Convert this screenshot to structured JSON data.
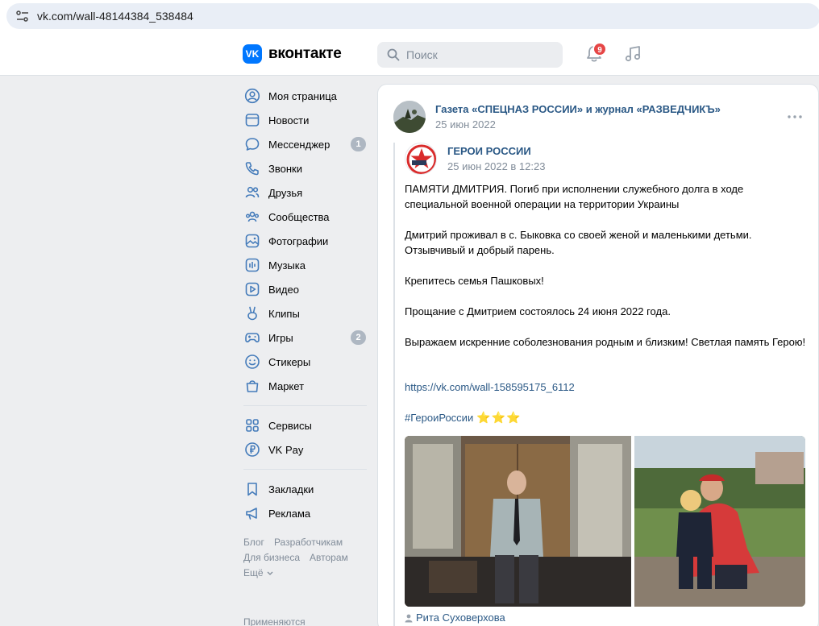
{
  "browser": {
    "url": "vk.com/wall-48144384_538484"
  },
  "header": {
    "logo_text": "вконтакте",
    "logo_mark": "VK",
    "search_placeholder": "Поиск",
    "notifications_count": "9",
    "brand_color": "#0077ff"
  },
  "sidebar": {
    "items": [
      {
        "label": "Моя страница",
        "icon": "user-circle-icon"
      },
      {
        "label": "Новости",
        "icon": "newsfeed-icon"
      },
      {
        "label": "Мессенджер",
        "icon": "message-icon",
        "count": "1"
      },
      {
        "label": "Звонки",
        "icon": "phone-icon"
      },
      {
        "label": "Друзья",
        "icon": "users-icon"
      },
      {
        "label": "Сообщества",
        "icon": "communities-icon"
      },
      {
        "label": "Фотографии",
        "icon": "photo-icon"
      },
      {
        "label": "Музыка",
        "icon": "music-icon"
      },
      {
        "label": "Видео",
        "icon": "video-icon"
      },
      {
        "label": "Клипы",
        "icon": "clips-icon"
      },
      {
        "label": "Игры",
        "icon": "gamepad-icon",
        "count": "2"
      },
      {
        "label": "Стикеры",
        "icon": "smile-icon"
      },
      {
        "label": "Маркет",
        "icon": "market-icon"
      }
    ],
    "items2": [
      {
        "label": "Сервисы",
        "icon": "services-icon"
      },
      {
        "label": "VK Pay",
        "icon": "vkpay-icon"
      }
    ],
    "items3": [
      {
        "label": "Закладки",
        "icon": "bookmark-icon"
      },
      {
        "label": "Реклама",
        "icon": "megaphone-icon"
      }
    ],
    "footer": {
      "blog": "Блог",
      "developers": "Разработчикам",
      "business": "Для бизнеса",
      "authors": "Авторам",
      "more": "Ещё"
    },
    "applied": "Применяются"
  },
  "post": {
    "author": "Газета «СПЕЦНАЗ РОССИИ» и журнал «РАЗВЕДЧИКЪ»",
    "date": "25 июн 2022",
    "repost": {
      "author": "ГЕРОИ РОССИИ",
      "date": "25 июн 2022 в 12:23"
    },
    "paragraphs": [
      "ПАМЯТИ ДМИТРИЯ. Погиб при исполнении служебного долга в ходе специальной военной операции на территории Украины",
      "Дмитрий проживал в с. Быковка со своей женой и маленькими детьми. Отзывчивый и добрый парень.",
      "Крепитесь семья Пашковых!",
      "Прощание с Дмитрием состоялось 24 июня 2022 года.",
      "Выражаем искренние соболезнования родным и близким! Светлая память Герою!"
    ],
    "link": "https://vk.com/wall-158595175_6112",
    "hashtag": "#ГероиРоссии",
    "stars": "⭐⭐⭐",
    "signer": "Рита Суховерхова",
    "link_color": "#2a5885"
  }
}
